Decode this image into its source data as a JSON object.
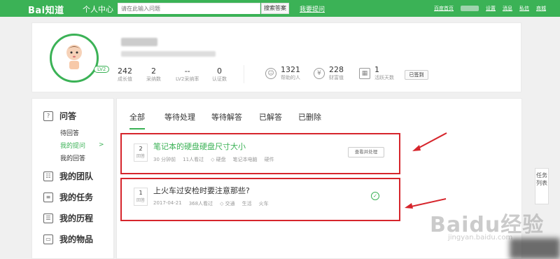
{
  "topbar": {
    "logo_text": "Bai知道",
    "section": "个人中心",
    "search_placeholder": "请在此输入问题",
    "search_button": "搜索答案",
    "ask_link": "我要提问",
    "links": [
      "百度首页",
      "设置",
      "消息",
      "私信",
      "商城"
    ]
  },
  "profile": {
    "level_badge": "LV2",
    "stats": [
      {
        "value": "242",
        "label": "成长值"
      },
      {
        "value": "2",
        "label": "采纳数"
      },
      {
        "value": "--",
        "label": "LV2采纳率"
      },
      {
        "value": "0",
        "label": "认证数"
      }
    ],
    "stats2": [
      {
        "value": "1321",
        "label": "帮助的人",
        "icon": "user-icon"
      },
      {
        "value": "228",
        "label": "财富值",
        "icon": "wealth-icon"
      },
      {
        "value": "1",
        "label": "活跃天数",
        "icon": "calendar-icon"
      }
    ],
    "signed_label": "已签到"
  },
  "sidebar": {
    "sections": [
      {
        "label": "问答",
        "icon": "question-icon",
        "subs": [
          "待回答",
          "我的提问",
          "我的回答"
        ]
      },
      {
        "label": "我的团队",
        "icon": "team-icon"
      },
      {
        "label": "我的任务",
        "icon": "task-icon"
      },
      {
        "label": "我的历程",
        "icon": "history-icon"
      },
      {
        "label": "我的物品",
        "icon": "box-icon"
      }
    ]
  },
  "tabs": [
    "全部",
    "等待处理",
    "等待解答",
    "已解答",
    "已删除"
  ],
  "questions": [
    {
      "count": "2",
      "count_unit": "回答",
      "title": "笔记本的硬盘硬盘尺寸大小",
      "time": "30 分钟前",
      "views": "11人看过",
      "tags": [
        "硬盘",
        "笔记本电脑",
        "硬件"
      ],
      "action": "查看并处理",
      "title_color": "#3bb256"
    },
    {
      "count": "1",
      "count_unit": "回答",
      "title": "上火车过安检时要注意那些?",
      "time": "2017-04-21",
      "views": "368人看过",
      "tags": [
        "交通",
        "生活",
        "火车"
      ],
      "title_color": "#333333"
    }
  ],
  "float_list": "任务列表",
  "watermark": {
    "brand": "Baidu经验",
    "url": "jingyan.baidu.com"
  },
  "accent": "#3bb256",
  "annotation_color": "#d6252c"
}
